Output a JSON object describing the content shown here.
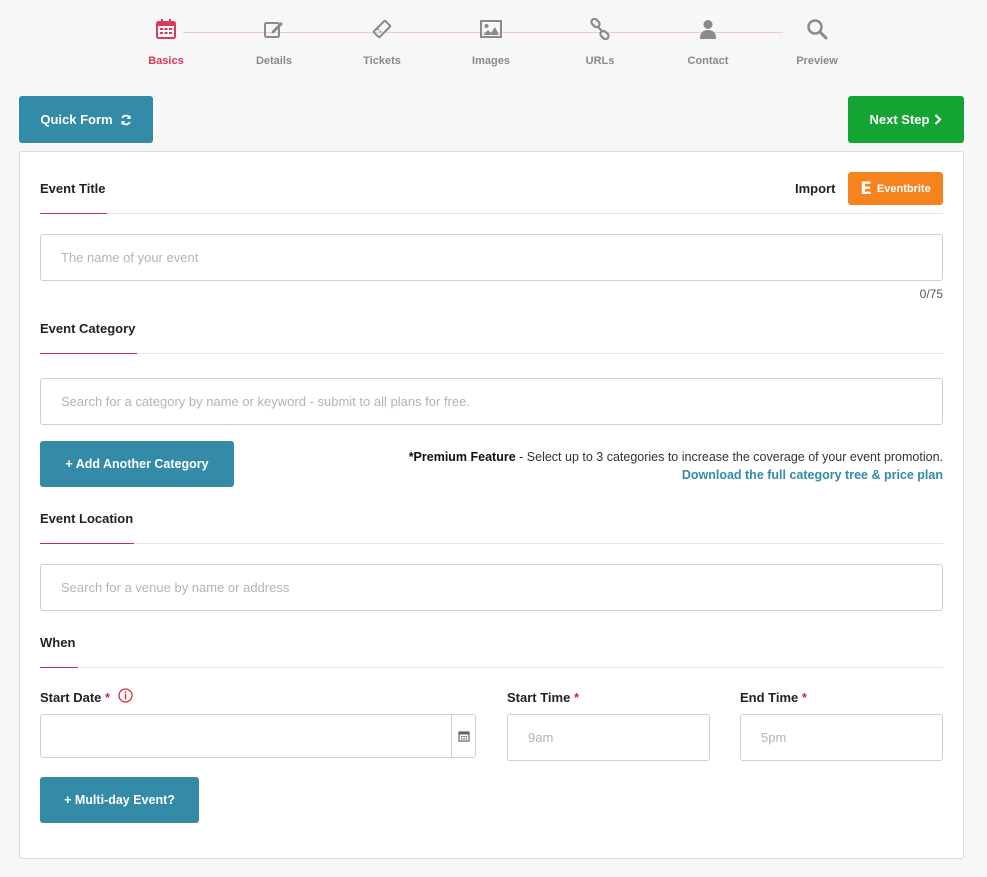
{
  "stepper": {
    "steps": [
      {
        "label": "Basics",
        "icon": "calendar-icon",
        "active": true
      },
      {
        "label": "Details",
        "icon": "edit-icon",
        "active": false
      },
      {
        "label": "Tickets",
        "icon": "ticket-icon",
        "active": false
      },
      {
        "label": "Images",
        "icon": "image-icon",
        "active": false
      },
      {
        "label": "URLs",
        "icon": "link-icon",
        "active": false
      },
      {
        "label": "Contact",
        "icon": "user-icon",
        "active": false
      },
      {
        "label": "Preview",
        "icon": "search-icon",
        "active": false
      }
    ]
  },
  "toolbar": {
    "quick_form_label": "Quick Form",
    "next_step_label": "Next Step"
  },
  "event_title": {
    "heading": "Event Title",
    "import_label": "Import",
    "eventbrite_label": "Eventbrite",
    "placeholder": "The name of your event",
    "counter": "0/75"
  },
  "event_category": {
    "heading": "Event Category",
    "placeholder": "Search for a category by name or keyword - submit to all plans for free.",
    "add_button_label": "+ Add Another Category",
    "premium_bold": "*Premium Feature",
    "premium_text": " - Select up to 3 categories to increase the coverage of your event promotion.",
    "download_link": "Download the full category tree & price plan"
  },
  "event_location": {
    "heading": "Event Location",
    "placeholder": "Search for a venue by name or address"
  },
  "when": {
    "heading": "When",
    "start_date_label": "Start Date",
    "start_time_label": "Start Time",
    "end_time_label": "End Time",
    "required_mark": "*",
    "start_time_placeholder": "9am",
    "end_time_placeholder": "5pm",
    "multi_day_label": "+ Multi-day Event?"
  },
  "colors": {
    "accent_pink": "#d93a5e",
    "primary_blue": "#338ba8",
    "success_green": "#13a434",
    "eventbrite_orange": "#f6841e"
  }
}
